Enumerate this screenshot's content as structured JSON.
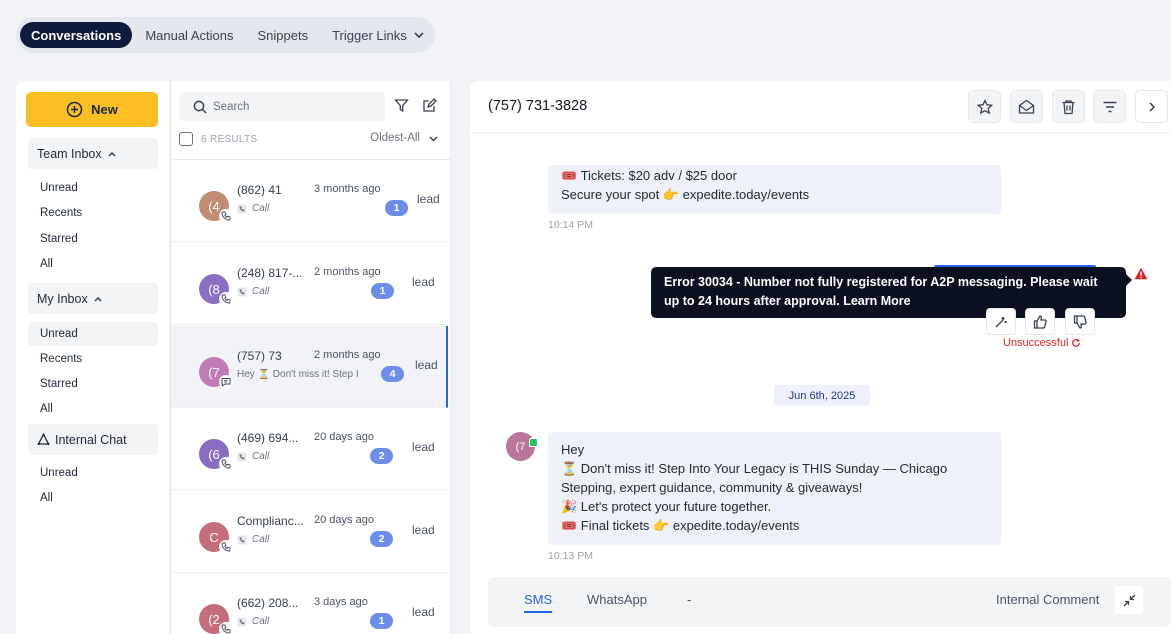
{
  "top_tabs": {
    "conversations": "Conversations",
    "manual_actions": "Manual Actions",
    "snippets": "Snippets",
    "trigger_links": "Trigger Links"
  },
  "sidebar": {
    "new_label": "New",
    "team_inbox": "Team Inbox",
    "team_items": [
      "Unread",
      "Recents",
      "Starred",
      "All"
    ],
    "my_inbox": "My Inbox",
    "my_items": [
      "Unread",
      "Recents",
      "Starred",
      "All"
    ],
    "internal_chat": "Internal Chat",
    "chat_items": [
      "Unread",
      "All"
    ]
  },
  "list": {
    "search_placeholder": "Search",
    "results": "6 RESULTS",
    "sort": "Oldest-All",
    "conversations": [
      {
        "initial": "(4",
        "avatar_color": "#c08d72",
        "name": "(862) 41",
        "time": "3 months ago",
        "sub": "Call",
        "type": "call",
        "count": "1",
        "tag": "lead"
      },
      {
        "initial": "(8",
        "avatar_color": "#8b6fc4",
        "name": "(248) 817-...",
        "time": "2 months ago",
        "sub": "Call",
        "type": "call",
        "count": "1",
        "tag": "lead"
      },
      {
        "initial": "(7",
        "avatar_color": "#c17bb6",
        "name": "(757) 73",
        "time": "2 months ago",
        "sub": "Hey ⏳ Don't miss it! Step I",
        "type": "sms",
        "count": "4",
        "tag": "lead"
      },
      {
        "initial": "(6",
        "avatar_color": "#8a6cc2",
        "name": "(469) 694...",
        "time": "20 days ago",
        "sub": "Call",
        "type": "call",
        "count": "2",
        "tag": "lead"
      },
      {
        "initial": "C",
        "avatar_color": "#c46d7b",
        "name": "Complianc...",
        "time": "20 days ago",
        "sub": "Call",
        "type": "call",
        "count": "2",
        "tag": "lead"
      },
      {
        "initial": "(2",
        "avatar_color": "#c46d7b",
        "name": "(662) 208...",
        "time": "3 days ago",
        "sub": "Call",
        "type": "call",
        "count": "1",
        "tag": "lead"
      }
    ]
  },
  "main": {
    "phone": "(757) 731-3828",
    "msg1_line1": "🎟️ Tickets: $20 adv / $25 door",
    "msg1_line2": "Secure your spot 👉 expedite.today/events",
    "msg1_time": "10:14 PM",
    "error_text": "Error 30034 - Number not fully registered for A2P messaging. Please wait up to 24 hours after approval. Learn More",
    "unsuccessful": "Unsuccessful",
    "date_divider": "Jun 6th, 2025",
    "inbound_initial": "(7",
    "msg2_lines": [
      "Hey",
      "⏳ Don't miss it! Step Into Your Legacy is THIS Sunday — Chicago",
      "Stepping, expert guidance, community & giveaways!",
      "🎉 Let's protect your future together.",
      "🎟️ Final tickets 👉 expedite.today/events"
    ],
    "msg2_time": "10:13 PM",
    "composer": {
      "sms": "SMS",
      "whatsapp": "WhatsApp",
      "dash": "-",
      "internal_comment": "Internal Comment"
    }
  }
}
